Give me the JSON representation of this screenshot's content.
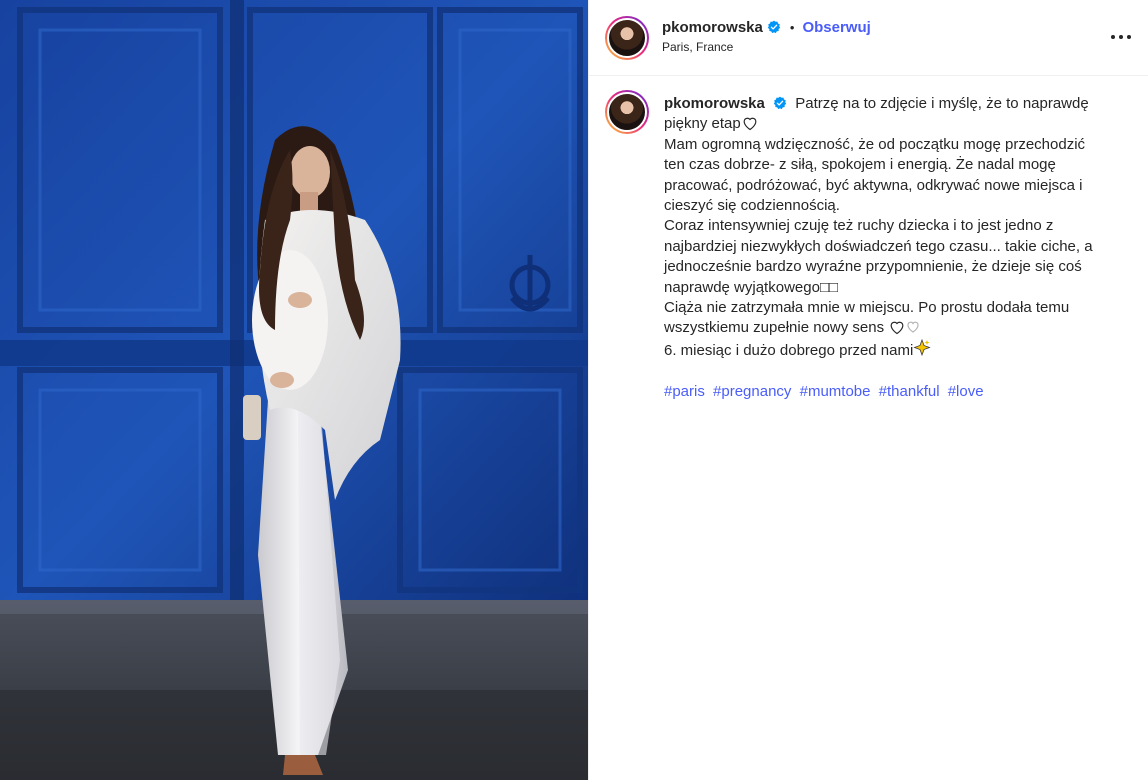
{
  "colors": {
    "link": "#4a5df9",
    "door_blue": "#1d4aa3",
    "text": "#262626",
    "verified": "#0095f6"
  },
  "photo": {
    "alt_icon": "pregnant-woman-photo"
  },
  "header": {
    "username": "pkomorowska",
    "separator": "•",
    "follow_label": "Obserwuj",
    "location": "Paris, France",
    "more_icon": "more-options-icon"
  },
  "caption": {
    "username": "pkomorowska",
    "lines": [
      "Patrzę na to zdjęcie i myślę, że to naprawdę piękny etap",
      "Mam ogromną wdzięczność, że od początku mogę przechodzić ten czas dobrze- z siłą, spokojem i energią. Że nadal mogę pracować, podróżować, być aktywna, odkrywać nowe miejsca i cieszyć się codziennością.",
      "Coraz intensywniej czuję też ruchy dziecka i to jest jedno z najbardziej niezwykłych doświadczeń tego czasu... takie ciche, a jednocześnie bardzo wyraźne przypomnienie, że dzieje się coś naprawdę wyjątkowego",
      "Ciąża nie zatrzymała mnie w miejscu. Po prostu dodała temu wszystkiemu zupełnie nowy sens",
      "6. miesiąc i dużo dobrego przed nami"
    ],
    "missing_glyphs": "□□",
    "hashtags": [
      "#paris",
      "#pregnancy",
      "#mumtobe",
      "#thankful",
      "#love"
    ]
  }
}
